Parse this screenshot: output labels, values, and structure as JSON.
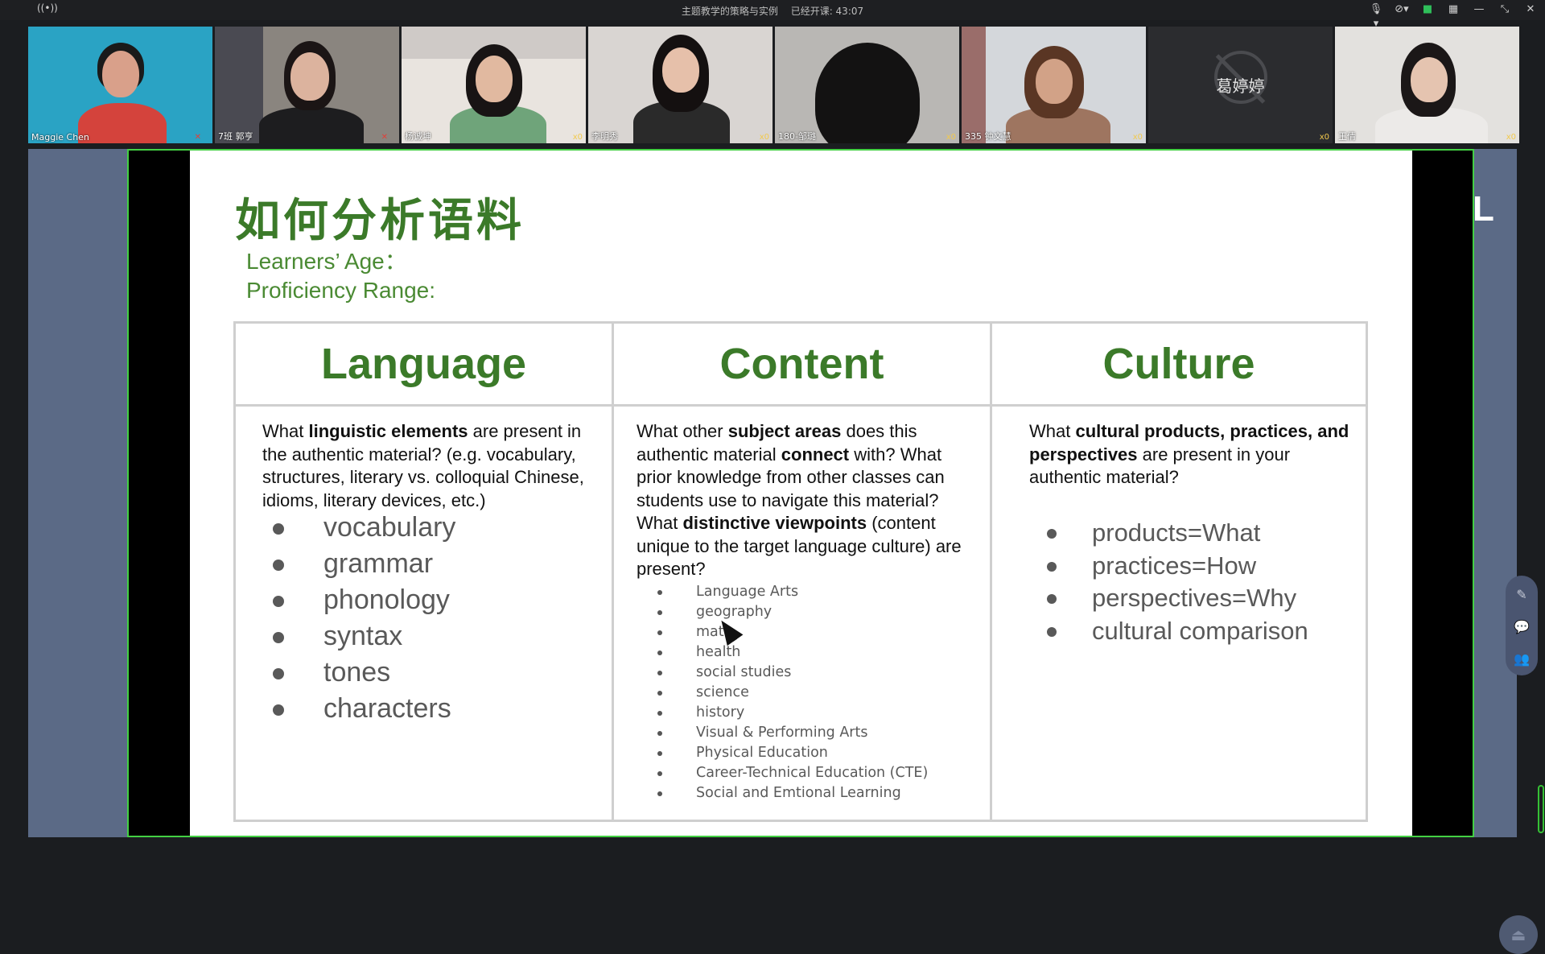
{
  "topbar": {
    "live_icon": "((•))",
    "course_title": "主题教学的策略与实例",
    "elapsed_label": "已经开课: 43:07",
    "icons": [
      "mic-icon",
      "camera-off-icon",
      "video-icon",
      "grid-icon",
      "minimize-icon",
      "restore-icon",
      "close-icon"
    ],
    "icon_glyphs": {
      "mic": "🎙▾",
      "cam_off": "⊘▾",
      "video": "■",
      "grid": "▦",
      "minimize": "—",
      "restore": "⤡",
      "close": "✕"
    }
  },
  "participants": [
    {
      "name": "Maggie Chen",
      "badge": "",
      "mic_muted": true
    },
    {
      "name": "7班 郭亨",
      "badge": "",
      "mic_muted": true
    },
    {
      "name": "杨诚坤",
      "badge": "x0",
      "mic_muted": false
    },
    {
      "name": "李明秀",
      "badge": "x0",
      "mic_muted": true
    },
    {
      "name": "180-邹璐",
      "badge": "x0",
      "mic_muted": true
    },
    {
      "name": "335 钟文慧",
      "badge": "x0",
      "mic_muted": false
    },
    {
      "name": "葛婷婷",
      "badge": "x0",
      "mic_muted": false
    },
    {
      "name": "王倩",
      "badge": "x0",
      "mic_muted": false
    }
  ],
  "slide": {
    "title": "如何分析语料",
    "meta_age": "Learners’ Age：",
    "meta_range": "Proficiency Range:",
    "columns": [
      {
        "header": "Language"
      },
      {
        "header": "Content"
      },
      {
        "header": "Culture"
      }
    ],
    "language": {
      "q_pre": "What ",
      "q_bold": "linguistic elements",
      "q_post": " are present in the authentic material? (e.g. vocabulary, structures, literary vs. colloquial Chinese, idioms, literary devices, etc.)",
      "items": [
        "vocabulary",
        "grammar",
        "phonology",
        "syntax",
        "tones",
        "characters"
      ]
    },
    "content": {
      "q1": "What other ",
      "q2": "subject areas",
      "q3": " does this authentic material ",
      "q4": "connect",
      "q5": " with? What prior knowledge from other classes can students use to navigate this material?  What ",
      "q6": "distinctive viewpoints",
      "q7": " (content unique to the target language culture) are present?",
      "items": [
        "Language Arts",
        "geography",
        "math",
        "health",
        "social studies",
        "science",
        "history",
        "Visual & Performing Arts",
        "Physical Education",
        "Career-Technical Education (CTE)",
        "Social and Emtional Learning"
      ]
    },
    "culture": {
      "q1": "What ",
      "q2": "cultural products, practices, and perspectives",
      "q3": " are present in your authentic material?",
      "items": [
        "products=What",
        "practices=How",
        "perspectives=Why",
        "cultural comparison"
      ]
    }
  },
  "overlay": {
    "right_letter": "L",
    "side_tools": [
      "edit-icon",
      "chat-icon",
      "users-icon"
    ],
    "side_glyphs": {
      "edit": "✎",
      "chat": "💬",
      "users": "👥"
    },
    "fab_glyph": "⏏"
  },
  "colors": {
    "accent_green": "#3b7a29",
    "frame_green": "#43d043",
    "stage_bg": "#5b6a86"
  }
}
